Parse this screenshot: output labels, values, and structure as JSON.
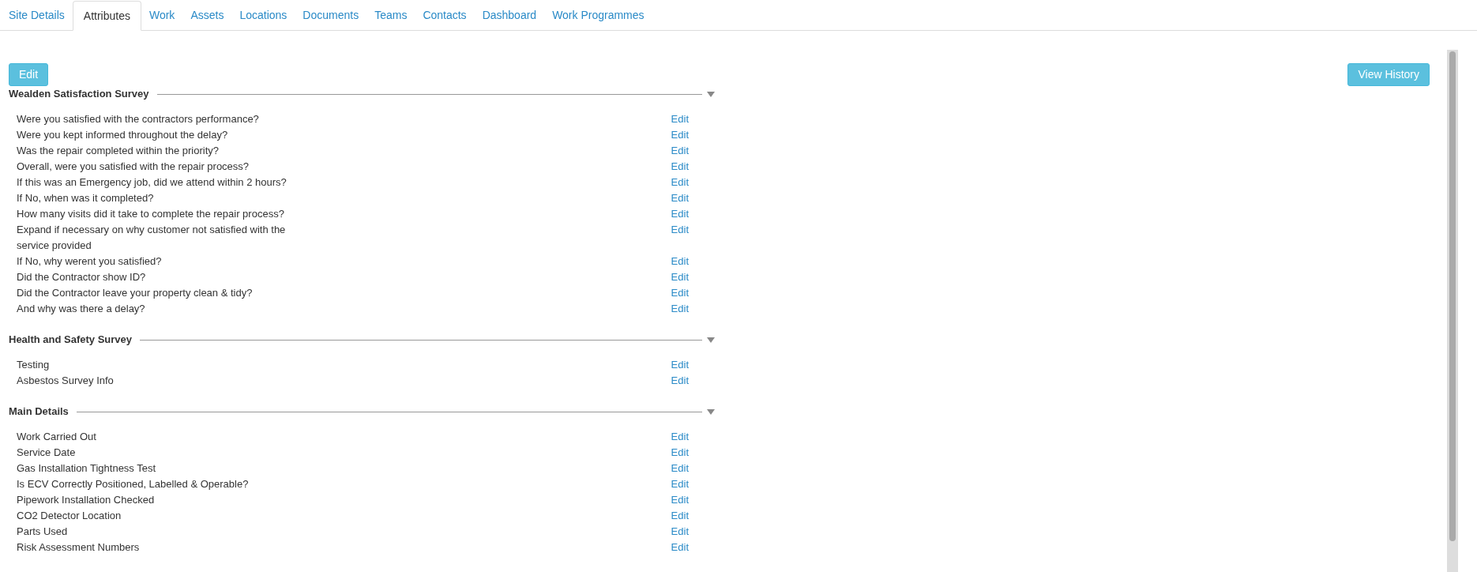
{
  "tabs": [
    {
      "label": "Site Details",
      "selected": false
    },
    {
      "label": "Attributes",
      "selected": true
    },
    {
      "label": "Work",
      "selected": false
    },
    {
      "label": "Assets",
      "selected": false
    },
    {
      "label": "Locations",
      "selected": false
    },
    {
      "label": "Documents",
      "selected": false
    },
    {
      "label": "Teams",
      "selected": false
    },
    {
      "label": "Contacts",
      "selected": false
    },
    {
      "label": "Dashboard",
      "selected": false
    },
    {
      "label": "Work Programmes",
      "selected": false
    }
  ],
  "toolbar": {
    "edit_button": "Edit",
    "history_button": "View History"
  },
  "sections": [
    {
      "title": "Wealden Satisfaction Survey",
      "expanded": true,
      "rows": [
        {
          "label": "Were you satisfied with the contractors performance?",
          "action": "Edit"
        },
        {
          "label": "Were you kept informed throughout the delay?",
          "action": "Edit"
        },
        {
          "label": "Was the repair completed within the priority?",
          "action": "Edit"
        },
        {
          "label": "Overall, were you satisfied with the repair process?",
          "action": "Edit"
        },
        {
          "label": "If this was an Emergency job, did we attend within 2 hours?",
          "action": "Edit"
        },
        {
          "label": "If No, when was it completed?",
          "action": "Edit"
        },
        {
          "label": "How many visits did it take to complete the repair process?",
          "action": "Edit"
        },
        {
          "label": "Expand if necessary on why customer not satisfied with the service provided",
          "action": "Edit"
        },
        {
          "label": "If No, why werent you satisfied?",
          "action": "Edit"
        },
        {
          "label": "Did the Contractor show ID?",
          "action": "Edit"
        },
        {
          "label": "Did the Contractor leave your property clean & tidy?",
          "action": "Edit"
        },
        {
          "label": "And why was there a delay?",
          "action": "Edit"
        }
      ]
    },
    {
      "title": "Health and Safety Survey",
      "expanded": true,
      "rows": [
        {
          "label": "Testing",
          "action": "Edit"
        },
        {
          "label": "Asbestos Survey Info",
          "action": "Edit"
        }
      ]
    },
    {
      "title": "Main Details",
      "expanded": true,
      "rows": [
        {
          "label": "Work Carried Out",
          "action": "Edit"
        },
        {
          "label": "Service Date",
          "action": "Edit"
        },
        {
          "label": "Gas Installation Tightness Test",
          "action": "Edit"
        },
        {
          "label": "Is ECV Correctly Positioned, Labelled & Operable?",
          "action": "Edit"
        },
        {
          "label": "Pipework Installation Checked",
          "action": "Edit"
        },
        {
          "label": "CO2 Detector Location",
          "action": "Edit"
        },
        {
          "label": "Parts Used",
          "action": "Edit"
        },
        {
          "label": "Risk Assessment Numbers",
          "action": "Edit"
        }
      ]
    }
  ]
}
